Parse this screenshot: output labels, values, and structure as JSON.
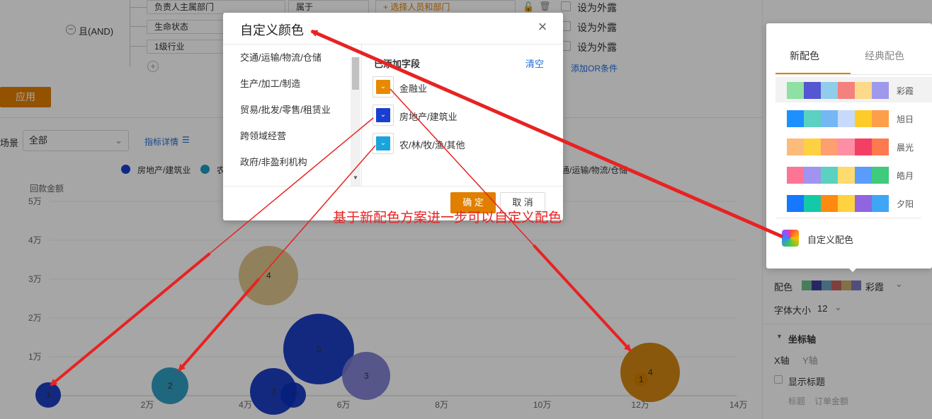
{
  "filter": {
    "rows": [
      {
        "field": "负责人主属部门",
        "operator": "属于",
        "value_placeholder": "+ 选择人员和部门",
        "expose_label": "设为外露"
      },
      {
        "field": "生命状态",
        "expose_label": "设为外露"
      },
      {
        "field": "1级行业",
        "expose_label": "设为外露"
      }
    ],
    "and_label": "且(AND)",
    "add_or_label": "添加OR条件",
    "apply_label": "应用"
  },
  "scene": {
    "label": "场景",
    "value": "全部",
    "metric_detail_label": "指标详情"
  },
  "legend": [
    {
      "name": "房地产/建筑业",
      "color": "#1a3fcf"
    },
    {
      "name": "农",
      "color": "#1f9bc2"
    }
  ],
  "legend_right_text": "通/运输/物流/仓储",
  "chart_data": {
    "type": "scatter",
    "ylabel": "回款金额",
    "y_ticks": [
      "5万",
      "4万",
      "3万",
      "2万",
      "1万"
    ],
    "x_ticks": [
      "2万",
      "4万",
      "6万",
      "8万",
      "10万",
      "12万",
      "14万"
    ],
    "xlim": [
      0,
      14
    ],
    "ylim": [
      0,
      5
    ],
    "points": [
      {
        "x": 0,
        "y": 0,
        "label": "1",
        "size": 18,
        "color": "#0b2fc0"
      },
      {
        "x": 1,
        "y": 0.25,
        "label": "2",
        "size": 26,
        "color": "#1f97bd"
      },
      {
        "x": 3.2,
        "y": 3.1,
        "label": "4",
        "size": 42,
        "color": "#dcc084"
      },
      {
        "x": 3.3,
        "y": 0.1,
        "label": "3",
        "size": 33,
        "color": "#0b2fc0"
      },
      {
        "x": 3.5,
        "y": 0.0,
        "label": "1",
        "size": 18,
        "color": "#0b2fc0"
      },
      {
        "x": 5,
        "y": 1.2,
        "label": "5",
        "size": 50,
        "color": "#0b2fc0"
      },
      {
        "x": 5.5,
        "y": 0.5,
        "label": "3",
        "size": 34,
        "color": "#7b7bd0"
      },
      {
        "x": 12.5,
        "y": 0.6,
        "label": "4",
        "size": 42,
        "color": "#d17e00"
      },
      {
        "x": 12.0,
        "y": 0.4,
        "label": "1",
        "size": 10,
        "color": "#d17e00"
      }
    ]
  },
  "modal": {
    "title": "自定义颜色",
    "categories": [
      "交通/运输/物流/仓储",
      "生产/加工/制造",
      "贸易/批发/零售/租赁业",
      "跨领域经营",
      "政府/非盈利机构"
    ],
    "added_fields_title": "已添加字段",
    "clear_label": "清空",
    "fields": [
      {
        "label": "金融业",
        "color": "#e88a00"
      },
      {
        "label": "房地产/建筑业",
        "color": "#1a3fcf"
      },
      {
        "label": "农/林/牧/渔/其他",
        "color": "#1aa4dd"
      }
    ],
    "ok_label": "确 定",
    "cancel_label": "取 消"
  },
  "annotation_text": "基于新配色方案进一步可以自定义配色",
  "popover": {
    "tab_new": "新配色",
    "tab_classic": "经典配色",
    "schemes": [
      {
        "name": "彩霞",
        "colors": [
          "#8ee0a3",
          "#5556d1",
          "#8fcdea",
          "#f4817e",
          "#fdd98a",
          "#9f99ec"
        ]
      },
      {
        "name": "旭日",
        "colors": [
          "#1e8fff",
          "#5ad1c1",
          "#74b8f3",
          "#c7dafb",
          "#fdcc2b",
          "#fd9f4a"
        ]
      },
      {
        "name": "晨光",
        "colors": [
          "#fdbb7b",
          "#fdd143",
          "#fd9f6e",
          "#fd8ea3",
          "#f43f65",
          "#fd7a4f"
        ]
      },
      {
        "name": "皓月",
        "colors": [
          "#fd7594",
          "#a194f0",
          "#5ad1c1",
          "#fddb6e",
          "#5a9cfb",
          "#3ecb7c"
        ]
      },
      {
        "name": "夕阳",
        "colors": [
          "#1677ff",
          "#13c9a7",
          "#ff8a0f",
          "#ffd23f",
          "#9164e0",
          "#3fa6f5"
        ]
      }
    ],
    "custom_label": "自定义配色"
  },
  "right_panel": {
    "color_label": "配色",
    "color_value": "彩霞",
    "color_preview": [
      "#6fbf8d",
      "#3c3d9f",
      "#6fa2bd",
      "#c46160",
      "#c8ae6d",
      "#7d78bd"
    ],
    "font_size_label": "字体大小",
    "font_size_value": "12",
    "axis_section": "坐标轴",
    "x_axis": "X轴",
    "y_axis": "Y轴",
    "show_title": "显示标题",
    "title_label": "标题",
    "title_value": "订单金额"
  }
}
